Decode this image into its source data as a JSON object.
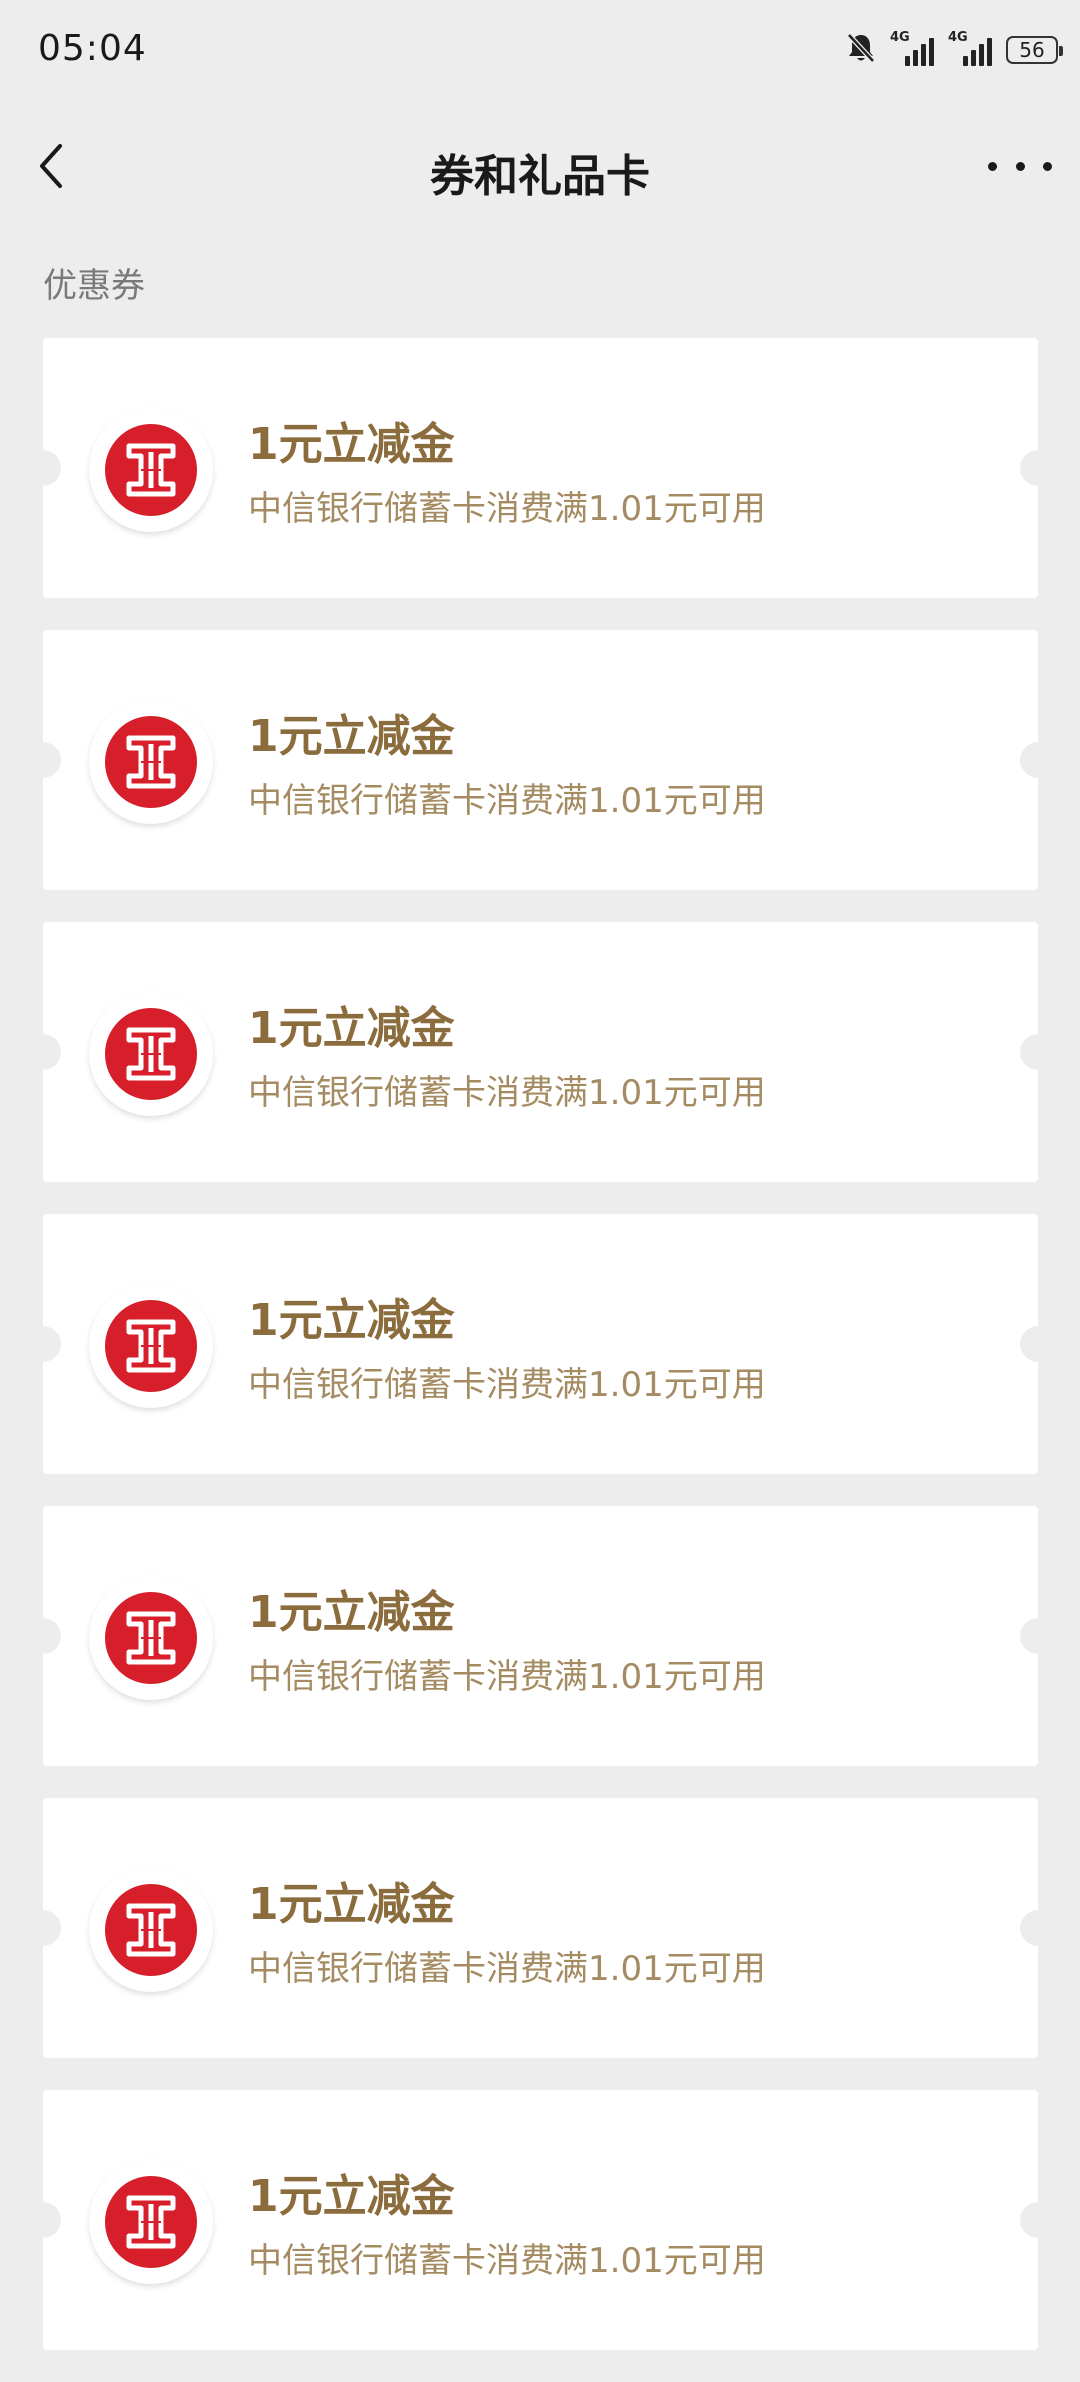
{
  "status_bar": {
    "time": "05:04",
    "network_1": "4G",
    "network_2": "4G",
    "battery": "56"
  },
  "nav": {
    "title": "券和礼品卡"
  },
  "section": {
    "label": "优惠券"
  },
  "coupons": [
    {
      "title": "1元立减金",
      "desc": "中信银行储蓄卡消费满1.01元可用"
    },
    {
      "title": "1元立减金",
      "desc": "中信银行储蓄卡消费满1.01元可用"
    },
    {
      "title": "1元立减金",
      "desc": "中信银行储蓄卡消费满1.01元可用"
    },
    {
      "title": "1元立减金",
      "desc": "中信银行储蓄卡消费满1.01元可用"
    },
    {
      "title": "1元立减金",
      "desc": "中信银行储蓄卡消费满1.01元可用"
    },
    {
      "title": "1元立减金",
      "desc": "中信银行储蓄卡消费满1.01元可用"
    },
    {
      "title": "1元立减金",
      "desc": "中信银行储蓄卡消费满1.01元可用"
    }
  ],
  "colors": {
    "page_bg": "#ededed",
    "card_bg": "#ffffff",
    "coupon_title": "#8b6c3c",
    "coupon_desc": "#a48b62",
    "logo_red": "#d71f2b"
  },
  "icons": {
    "back": "chevron-left-icon",
    "more": "more-dots-icon",
    "mute": "bell-mute-icon",
    "logo": "citic-bank-logo-icon"
  }
}
